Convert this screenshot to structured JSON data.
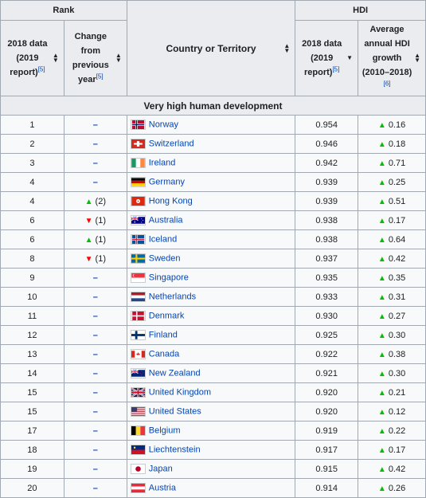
{
  "headers": {
    "rank": "Rank",
    "hdi": "HDI",
    "data2018": "2018 data",
    "data2019": "(2019",
    "report": "report)",
    "ref5": "[5]",
    "change1": "Change",
    "change2": "from",
    "change3": "previous",
    "change4": "year",
    "country": "Country or Territory",
    "avg1": "Average",
    "avg2": "annual HDI",
    "avg3": "growth",
    "avg4": "(2010–2018)",
    "ref6": "[6]"
  },
  "section_label": "Very high human development",
  "dash": "–",
  "rows": [
    {
      "rank": "1",
      "change_dir": "none",
      "change": "",
      "country": "Norway",
      "flag": "norway",
      "hdi": "0.954",
      "growth": "0.16"
    },
    {
      "rank": "2",
      "change_dir": "none",
      "change": "",
      "country": "Switzerland",
      "flag": "switzerland",
      "hdi": "0.946",
      "growth": "0.18"
    },
    {
      "rank": "3",
      "change_dir": "none",
      "change": "",
      "country": "Ireland",
      "flag": "ireland",
      "hdi": "0.942",
      "growth": "0.71"
    },
    {
      "rank": "4",
      "change_dir": "none",
      "change": "",
      "country": "Germany",
      "flag": "germany",
      "hdi": "0.939",
      "growth": "0.25"
    },
    {
      "rank": "4",
      "change_dir": "up",
      "change": "(2)",
      "country": "Hong Kong",
      "flag": "hongkong",
      "hdi": "0.939",
      "growth": "0.51"
    },
    {
      "rank": "6",
      "change_dir": "down",
      "change": "(1)",
      "country": "Australia",
      "flag": "australia",
      "hdi": "0.938",
      "growth": "0.17"
    },
    {
      "rank": "6",
      "change_dir": "up",
      "change": "(1)",
      "country": "Iceland",
      "flag": "iceland",
      "hdi": "0.938",
      "growth": "0.64"
    },
    {
      "rank": "8",
      "change_dir": "down",
      "change": "(1)",
      "country": "Sweden",
      "flag": "sweden",
      "hdi": "0.937",
      "growth": "0.42"
    },
    {
      "rank": "9",
      "change_dir": "none",
      "change": "",
      "country": "Singapore",
      "flag": "singapore",
      "hdi": "0.935",
      "growth": "0.35"
    },
    {
      "rank": "10",
      "change_dir": "none",
      "change": "",
      "country": "Netherlands",
      "flag": "netherlands",
      "hdi": "0.933",
      "growth": "0.31"
    },
    {
      "rank": "11",
      "change_dir": "none",
      "change": "",
      "country": "Denmark",
      "flag": "denmark",
      "hdi": "0.930",
      "growth": "0.27"
    },
    {
      "rank": "12",
      "change_dir": "none",
      "change": "",
      "country": "Finland",
      "flag": "finland",
      "hdi": "0.925",
      "growth": "0.30"
    },
    {
      "rank": "13",
      "change_dir": "none",
      "change": "",
      "country": "Canada",
      "flag": "canada",
      "hdi": "0.922",
      "growth": "0.38"
    },
    {
      "rank": "14",
      "change_dir": "none",
      "change": "",
      "country": "New Zealand",
      "flag": "newzealand",
      "hdi": "0.921",
      "growth": "0.30"
    },
    {
      "rank": "15",
      "change_dir": "none",
      "change": "",
      "country": "United Kingdom",
      "flag": "uk",
      "hdi": "0.920",
      "growth": "0.21"
    },
    {
      "rank": "15",
      "change_dir": "none",
      "change": "",
      "country": "United States",
      "flag": "usa",
      "hdi": "0.920",
      "growth": "0.12"
    },
    {
      "rank": "17",
      "change_dir": "none",
      "change": "",
      "country": "Belgium",
      "flag": "belgium",
      "hdi": "0.919",
      "growth": "0.22"
    },
    {
      "rank": "18",
      "change_dir": "none",
      "change": "",
      "country": "Liechtenstein",
      "flag": "liechtenstein",
      "hdi": "0.917",
      "growth": "0.17"
    },
    {
      "rank": "19",
      "change_dir": "none",
      "change": "",
      "country": "Japan",
      "flag": "japan",
      "hdi": "0.915",
      "growth": "0.42"
    },
    {
      "rank": "20",
      "change_dir": "none",
      "change": "",
      "country": "Austria",
      "flag": "austria",
      "hdi": "0.914",
      "growth": "0.26"
    }
  ]
}
